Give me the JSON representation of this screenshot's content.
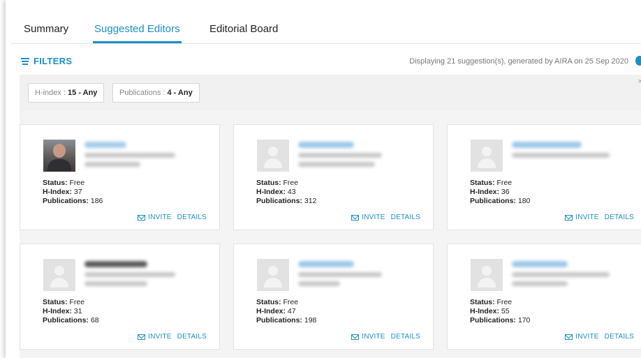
{
  "tabs": [
    {
      "label": "Summary"
    },
    {
      "label": "Suggested Editors",
      "active": true
    },
    {
      "label": "Editorial Board"
    }
  ],
  "filters": {
    "label": "FILTERS",
    "display_note": "Displaying 21 suggestion(s), generated by AIRA on 25 Sep 2020",
    "chips": [
      {
        "key": "H-index :",
        "value": "15 - Any"
      },
      {
        "key": "Publications :",
        "value": "4 - Any"
      }
    ],
    "close_symbol": "×"
  },
  "labels": {
    "status": "Status:",
    "hindex": "H-Index:",
    "publications": "Publications:",
    "invite": "INVITE",
    "details": "DETAILS"
  },
  "cards": [
    {
      "status": "Free",
      "hindex": "37",
      "publications": "186",
      "photo": true
    },
    {
      "status": "Free",
      "hindex": "43",
      "publications": "312",
      "photo": false
    },
    {
      "status": "Free",
      "hindex": "36",
      "publications": "180",
      "photo": false
    },
    {
      "status": "Free",
      "hindex": "31",
      "publications": "68",
      "photo": false
    },
    {
      "status": "Free",
      "hindex": "47",
      "publications": "198",
      "photo": false
    },
    {
      "status": "Free",
      "hindex": "55",
      "publications": "170",
      "photo": false
    }
  ],
  "colors": {
    "accent": "#1a8fc7",
    "blurred_name": "#9cc8e8",
    "blurred_name_dark": "#5b5b5b"
  }
}
